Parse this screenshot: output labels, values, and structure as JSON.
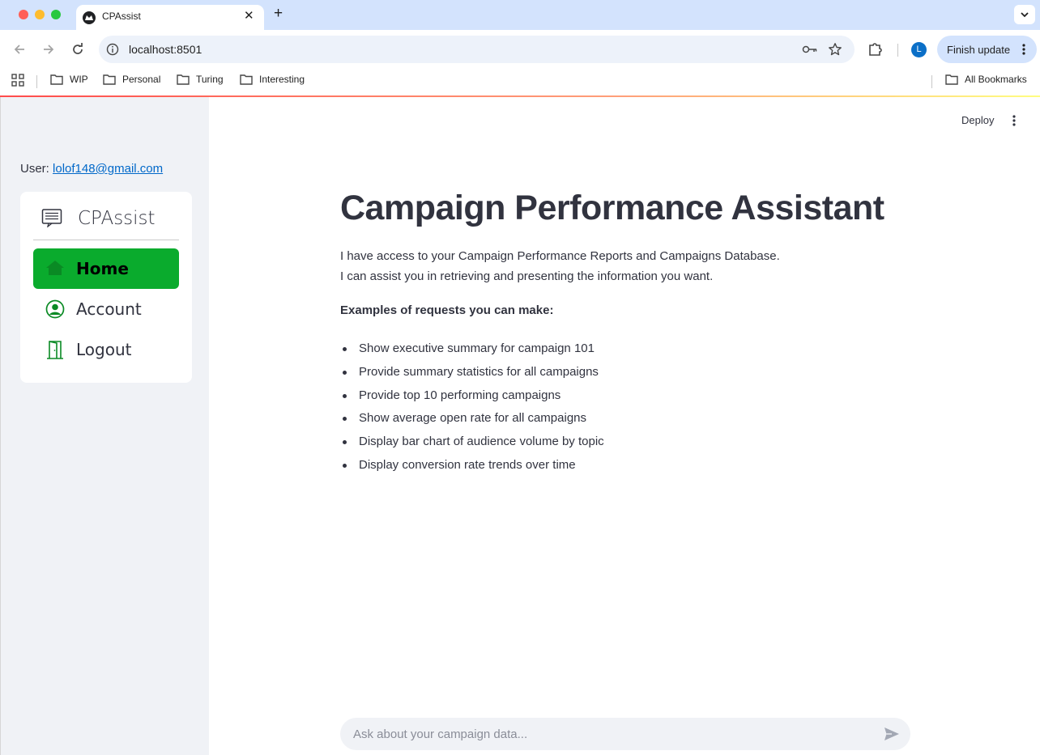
{
  "browser": {
    "tab_title": "CPAssist",
    "url": "localhost:8501",
    "finish_update_label": "Finish update",
    "profile_initial": "L",
    "bookmarks": [
      "WIP",
      "Personal",
      "Turing",
      "Interesting"
    ],
    "all_bookmarks_label": "All Bookmarks"
  },
  "sidebar": {
    "user_prefix": "User:",
    "user_email": "lolof148@gmail.com",
    "brand": "CPAssist",
    "menu": [
      {
        "label": "Home",
        "icon": "home-icon",
        "active": true
      },
      {
        "label": "Account",
        "icon": "user-circle-icon",
        "active": false
      },
      {
        "label": "Logout",
        "icon": "door-icon",
        "active": false
      }
    ],
    "active_color": "#0aab2d",
    "icon_color": "#0a8a24"
  },
  "header": {
    "deploy_label": "Deploy"
  },
  "main": {
    "title": "Campaign Performance Assistant",
    "intro_line1": "I have access to your Campaign Performance Reports and Campaigns Database.",
    "intro_line2": "I can assist you in retrieving and presenting the information you want.",
    "examples_heading": "Examples of requests you can make:",
    "examples": [
      "Show executive summary for campaign 101",
      "Provide summary statistics for all campaigns",
      "Provide top 10 performing campaigns",
      "Show average open rate for all campaigns",
      "Display bar chart of audience volume by topic",
      "Display conversion rate trends over time"
    ]
  },
  "chat": {
    "placeholder": "Ask about your campaign data...",
    "value": ""
  }
}
